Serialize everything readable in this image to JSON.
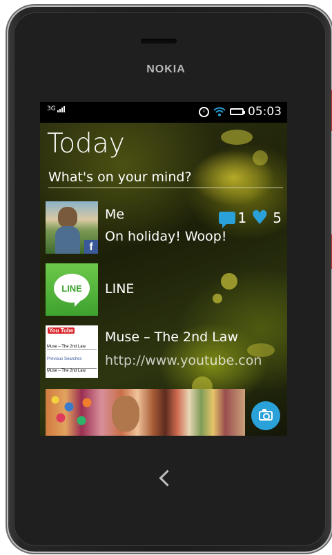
{
  "device": {
    "brand": "NOKIA"
  },
  "status_bar": {
    "network": "3G",
    "time": "05:03",
    "icons": [
      "signal-icon",
      "alarm-icon",
      "wifi-icon",
      "battery-icon"
    ]
  },
  "home": {
    "title": "Today",
    "status_prompt": "What's on your mind?"
  },
  "feed": [
    {
      "sender": "Me",
      "text": "On holiday! Woop!",
      "comments": "1",
      "likes": "5",
      "source_icon": "facebook-icon"
    },
    {
      "sender": "LINE",
      "app_logo_text": "LINE"
    },
    {
      "sender": "Muse – The 2nd Law",
      "text": "http://www.youtube.con",
      "thumb": {
        "logo": "You Tube",
        "row1": "Muse – The 2nd Law",
        "row2": "Previous Searches",
        "row3": "Muse – The 2nd Law"
      }
    }
  ],
  "colors": {
    "accent": "#2aa2d9",
    "facebook": "#3b5998",
    "line_green": "#4bb43a"
  }
}
